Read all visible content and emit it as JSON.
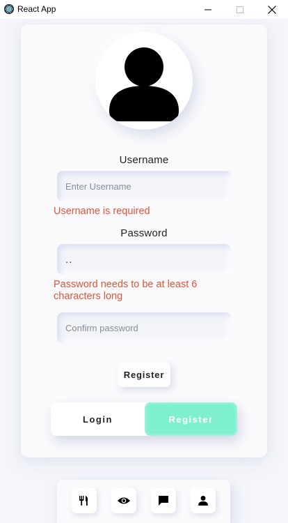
{
  "window": {
    "title": "React App"
  },
  "form": {
    "username_label": "Username",
    "username_placeholder": "Enter Username",
    "username_value": "",
    "username_error": "Username is required",
    "password_label": "Password",
    "password_value": "..",
    "password_error": "Password needs to be at least 6 characters long",
    "confirm_placeholder": "Confirm password",
    "confirm_value": "",
    "submit_label": "Register"
  },
  "toggle": {
    "login_label": "Login",
    "register_label": "Register",
    "active": "Register"
  },
  "nav": {
    "items": [
      {
        "icon": "utensils-icon"
      },
      {
        "icon": "eye-icon"
      },
      {
        "icon": "chat-icon"
      },
      {
        "icon": "user-icon"
      }
    ]
  },
  "colors": {
    "error": "#e2533a",
    "accent": "#7ff0cf",
    "background": "#f5f6fb"
  }
}
